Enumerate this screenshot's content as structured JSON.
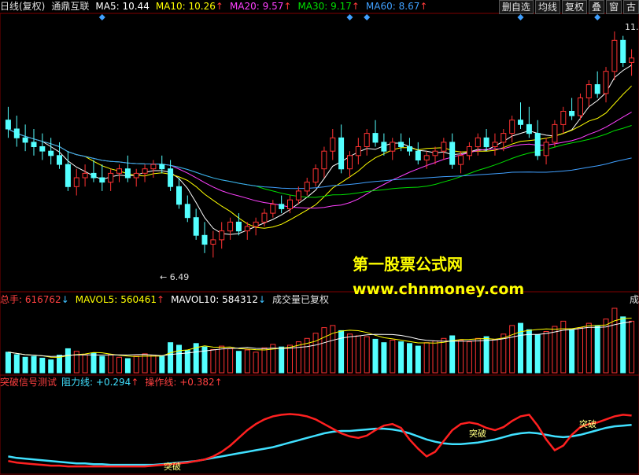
{
  "header": {
    "period": "日线(复权)",
    "name": "通鼎互联",
    "ma5": {
      "label": "MA5:",
      "value": "10.44",
      "color": "#ffffff"
    },
    "ma10": {
      "label": "MA10:",
      "value": "10.26",
      "color": "#ffff00"
    },
    "ma20": {
      "label": "MA20:",
      "value": "9.57",
      "color": "#ff40ff"
    },
    "ma30": {
      "label": "MA30:",
      "value": "9.17",
      "color": "#00e000"
    },
    "ma60": {
      "label": "MA60:",
      "value": "8.67",
      "color": "#40a0ff"
    }
  },
  "toolbar": {
    "b1": "删自选",
    "b2": "均线",
    "b3": "复权",
    "b4": "叠",
    "b5": "窗",
    "b6": "古"
  },
  "price_marks": {
    "high": "11.",
    "low": "6.49"
  },
  "volume_header": {
    "total": {
      "label": "总手:",
      "value": "616762"
    },
    "mavol5": {
      "label": "MAVOL5:",
      "value": "560461"
    },
    "mavol10": {
      "label": "MAVOL10:",
      "value": "584312"
    },
    "note": "成交量已复权",
    "right": "成"
  },
  "indicator_header": {
    "title": "突破信号测试",
    "resist": {
      "label": "阻力线:",
      "value": "+0.294"
    },
    "operate": {
      "label": "操作线:",
      "value": "+0.382"
    }
  },
  "signals": {
    "s1": "突破",
    "s2": "突破",
    "s3": "突破"
  },
  "watermark": {
    "line1": "第一股票公式网",
    "line2": "www.chnmoney.com"
  },
  "chart_data": {
    "type": "candlestick",
    "title": "通鼎互联 日线(复权)",
    "low_label": 6.49,
    "price_range": [
      6.1,
      11.6
    ],
    "candles": [
      [
        9.6,
        9.9,
        9.2,
        9.4
      ],
      [
        9.4,
        9.7,
        9.0,
        9.2
      ],
      [
        9.2,
        9.5,
        8.9,
        9.1
      ],
      [
        9.1,
        9.4,
        8.8,
        9.0
      ],
      [
        9.0,
        9.3,
        8.7,
        8.9
      ],
      [
        8.9,
        9.2,
        8.6,
        8.8
      ],
      [
        8.8,
        9.1,
        8.5,
        8.6
      ],
      [
        8.6,
        8.9,
        8.0,
        8.1
      ],
      [
        8.1,
        8.5,
        7.9,
        8.3
      ],
      [
        8.3,
        8.6,
        8.1,
        8.4
      ],
      [
        8.4,
        8.7,
        8.2,
        8.3
      ],
      [
        8.3,
        8.6,
        8.0,
        8.2
      ],
      [
        8.2,
        8.5,
        8.0,
        8.4
      ],
      [
        8.4,
        8.6,
        8.2,
        8.5
      ],
      [
        8.5,
        8.8,
        8.2,
        8.3
      ],
      [
        8.3,
        8.5,
        8.1,
        8.4
      ],
      [
        8.4,
        8.6,
        8.2,
        8.5
      ],
      [
        8.5,
        8.7,
        8.3,
        8.6
      ],
      [
        8.6,
        8.8,
        8.4,
        8.5
      ],
      [
        8.5,
        8.7,
        8.0,
        8.1
      ],
      [
        8.1,
        8.3,
        7.6,
        7.7
      ],
      [
        7.7,
        7.9,
        7.3,
        7.4
      ],
      [
        7.4,
        7.6,
        6.9,
        7.0
      ],
      [
        7.0,
        7.3,
        6.6,
        6.8
      ],
      [
        6.8,
        7.1,
        6.5,
        6.9
      ],
      [
        6.9,
        7.3,
        6.7,
        7.1
      ],
      [
        7.1,
        7.4,
        6.9,
        7.3
      ],
      [
        7.3,
        7.5,
        7.0,
        7.1
      ],
      [
        7.1,
        7.3,
        6.9,
        7.2
      ],
      [
        7.2,
        7.4,
        7.0,
        7.3
      ],
      [
        7.3,
        7.6,
        7.2,
        7.5
      ],
      [
        7.5,
        7.8,
        7.4,
        7.7
      ],
      [
        7.7,
        7.9,
        7.5,
        7.6
      ],
      [
        7.6,
        7.9,
        7.5,
        7.8
      ],
      [
        7.8,
        8.1,
        7.7,
        8.0
      ],
      [
        8.0,
        8.3,
        7.9,
        8.2
      ],
      [
        8.2,
        8.6,
        8.1,
        8.5
      ],
      [
        8.5,
        9.0,
        8.3,
        8.9
      ],
      [
        8.9,
        9.4,
        8.7,
        9.2
      ],
      [
        9.2,
        9.5,
        8.4,
        8.5
      ],
      [
        8.5,
        8.9,
        8.3,
        8.8
      ],
      [
        8.8,
        9.2,
        8.6,
        9.0
      ],
      [
        9.0,
        9.4,
        8.8,
        9.3
      ],
      [
        9.3,
        9.6,
        9.0,
        9.1
      ],
      [
        9.1,
        9.3,
        8.8,
        8.9
      ],
      [
        8.9,
        9.2,
        8.7,
        9.1
      ],
      [
        9.1,
        9.3,
        8.9,
        9.0
      ],
      [
        9.0,
        9.2,
        8.8,
        8.9
      ],
      [
        8.9,
        9.1,
        8.6,
        8.7
      ],
      [
        8.7,
        8.9,
        8.5,
        8.8
      ],
      [
        8.8,
        9.0,
        8.6,
        8.9
      ],
      [
        8.9,
        9.2,
        8.7,
        9.1
      ],
      [
        9.1,
        9.3,
        8.5,
        8.6
      ],
      [
        8.6,
        8.9,
        8.4,
        8.8
      ],
      [
        8.8,
        9.1,
        8.7,
        9.0
      ],
      [
        9.0,
        9.3,
        8.8,
        9.2
      ],
      [
        9.2,
        9.4,
        8.9,
        9.0
      ],
      [
        9.0,
        9.3,
        8.8,
        9.1
      ],
      [
        9.1,
        9.4,
        8.9,
        9.3
      ],
      [
        9.3,
        9.7,
        9.1,
        9.6
      ],
      [
        9.6,
        10.0,
        9.4,
        9.5
      ],
      [
        9.5,
        9.9,
        9.2,
        9.3
      ],
      [
        9.3,
        9.6,
        8.7,
        8.8
      ],
      [
        8.8,
        9.2,
        8.6,
        9.1
      ],
      [
        9.1,
        9.6,
        9.0,
        9.5
      ],
      [
        9.5,
        9.9,
        9.3,
        9.8
      ],
      [
        9.8,
        10.1,
        9.6,
        9.7
      ],
      [
        9.7,
        10.2,
        9.6,
        10.1
      ],
      [
        10.1,
        10.5,
        9.9,
        10.4
      ],
      [
        10.4,
        10.7,
        10.1,
        10.2
      ],
      [
        10.2,
        10.8,
        10.0,
        10.7
      ],
      [
        10.7,
        11.6,
        10.5,
        11.4
      ],
      [
        11.4,
        11.5,
        10.8,
        10.9
      ],
      [
        10.9,
        11.2,
        10.6,
        11.0
      ]
    ],
    "volume": [
      480,
      420,
      360,
      380,
      340,
      300,
      410,
      560,
      500,
      420,
      460,
      380,
      420,
      360,
      330,
      390,
      440,
      410,
      380,
      700,
      640,
      520,
      680,
      600,
      540,
      620,
      560,
      500,
      530,
      480,
      580,
      660,
      600,
      640,
      720,
      800,
      920,
      1050,
      1100,
      980,
      900,
      860,
      840,
      780,
      700,
      760,
      720,
      680,
      620,
      700,
      740,
      800,
      860,
      760,
      720,
      800,
      840,
      780,
      900,
      1100,
      1150,
      1000,
      880,
      960,
      1080,
      1200,
      1000,
      1050,
      1150,
      1100,
      1250,
      1500,
      1300,
      1200
    ],
    "indicator": {
      "resist": [
        0.18,
        0.16,
        0.15,
        0.14,
        0.13,
        0.12,
        0.11,
        0.1,
        0.09,
        0.09,
        0.08,
        0.08,
        0.07,
        0.07,
        0.07,
        0.07,
        0.07,
        0.07,
        0.08,
        0.09,
        0.1,
        0.11,
        0.12,
        0.14,
        0.16,
        0.18,
        0.2,
        0.22,
        0.24,
        0.26,
        0.28,
        0.3,
        0.33,
        0.36,
        0.39,
        0.42,
        0.45,
        0.48,
        0.5,
        0.51,
        0.51,
        0.52,
        0.53,
        0.54,
        0.54,
        0.53,
        0.51,
        0.48,
        0.44,
        0.4,
        0.37,
        0.35,
        0.34,
        0.34,
        0.35,
        0.36,
        0.38,
        0.4,
        0.43,
        0.46,
        0.48,
        0.49,
        0.48,
        0.46,
        0.44,
        0.43,
        0.44,
        0.46,
        0.49,
        0.52,
        0.55,
        0.57,
        0.58,
        0.59
      ],
      "operate": [
        0.12,
        0.1,
        0.09,
        0.08,
        0.07,
        0.06,
        0.06,
        0.05,
        0.05,
        0.05,
        0.05,
        0.05,
        0.05,
        0.05,
        0.05,
        0.05,
        0.05,
        0.06,
        0.07,
        0.08,
        0.09,
        0.1,
        0.12,
        0.14,
        0.18,
        0.24,
        0.32,
        0.42,
        0.52,
        0.6,
        0.66,
        0.7,
        0.72,
        0.73,
        0.72,
        0.7,
        0.66,
        0.6,
        0.54,
        0.48,
        0.44,
        0.42,
        0.45,
        0.52,
        0.58,
        0.6,
        0.55,
        0.4,
        0.28,
        0.18,
        0.24,
        0.38,
        0.52,
        0.6,
        0.62,
        0.6,
        0.55,
        0.52,
        0.56,
        0.64,
        0.7,
        0.72,
        0.58,
        0.4,
        0.26,
        0.32,
        0.46,
        0.56,
        0.6,
        0.62,
        0.66,
        0.7,
        0.72,
        0.71
      ]
    }
  }
}
